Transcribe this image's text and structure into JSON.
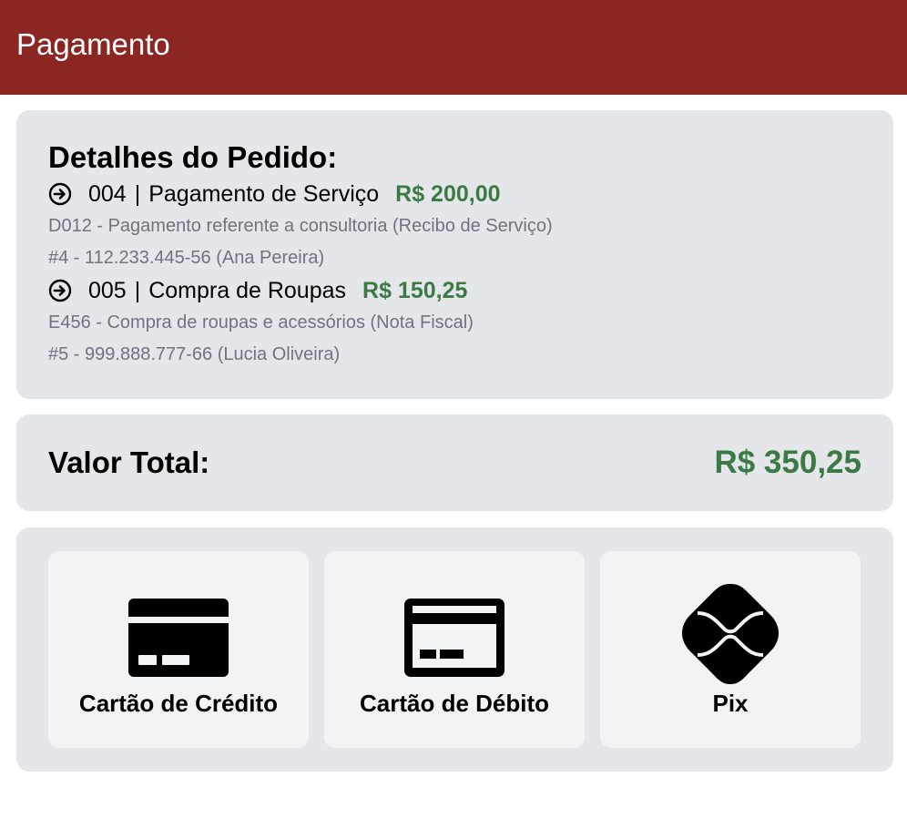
{
  "header": {
    "title": "Pagamento"
  },
  "order": {
    "heading": "Detalhes do Pedido:",
    "items": [
      {
        "code": "004",
        "separator": "|",
        "name": "Pagamento de Serviço",
        "amount": "R$ 200,00",
        "description": "D012 - Pagamento referente a consultoria (Recibo de Serviço)",
        "customer": "#4 - 112.233.445-56 (Ana Pereira)"
      },
      {
        "code": "005",
        "separator": "|",
        "name": "Compra de Roupas",
        "amount": "R$ 150,25",
        "description": "E456 - Compra de roupas e acessórios (Nota Fiscal)",
        "customer": "#5 - 999.888.777-66 (Lucia Oliveira)"
      }
    ]
  },
  "total": {
    "label": "Valor Total:",
    "value": "R$ 350,25"
  },
  "payment_methods": [
    {
      "label": "Cartão de Crédito",
      "icon": "credit-card-icon"
    },
    {
      "label": "Cartão de Débito",
      "icon": "debit-card-icon"
    },
    {
      "label": "Pix",
      "icon": "pix-icon"
    }
  ],
  "colors": {
    "header": "#8b2622",
    "amount": "#3b7a45",
    "card_bg": "#e5e6ea",
    "option_bg": "#f2f3f5",
    "muted_text": "#6f7380"
  }
}
